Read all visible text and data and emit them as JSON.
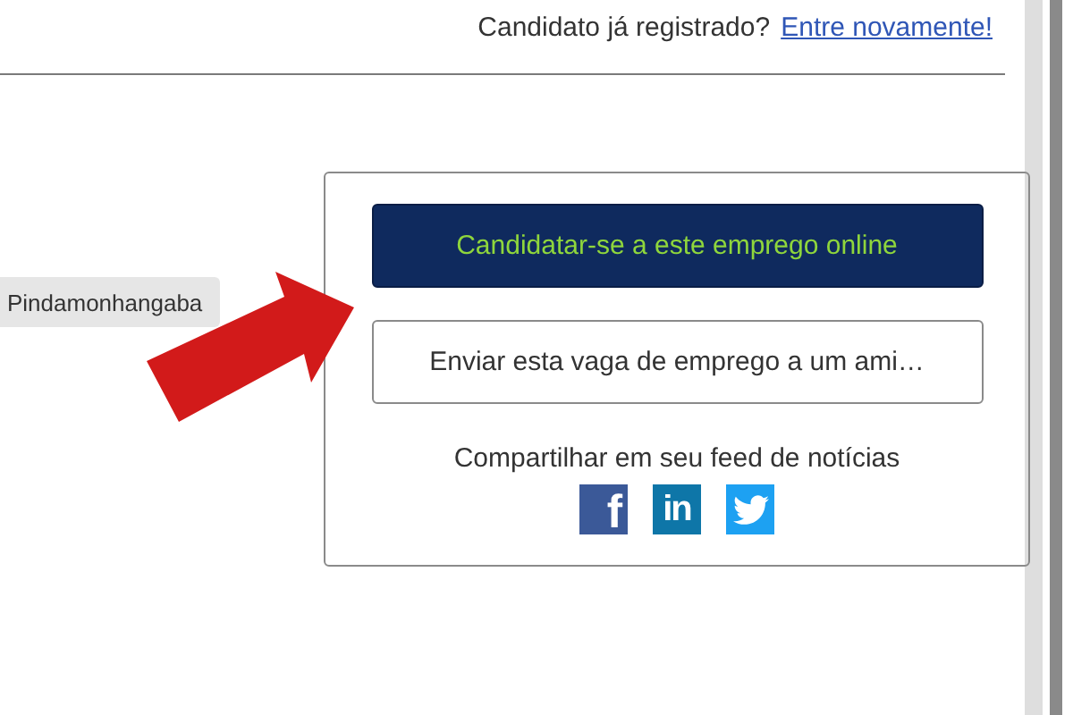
{
  "header": {
    "question": "Candidato já registrado?",
    "login_link": "Entre novamente!"
  },
  "location_tag": "Pindamonhangaba",
  "apply_card": {
    "apply_button": "Candidatar-se a este emprego online",
    "send_button": "Enviar esta vaga de emprego a um ami…",
    "share_label": "Compartilhar em seu feed de notícias",
    "share_buttons": [
      {
        "kind": "facebook",
        "glyph": "f"
      },
      {
        "kind": "linkedin",
        "glyph": "in"
      },
      {
        "kind": "twitter"
      }
    ]
  }
}
